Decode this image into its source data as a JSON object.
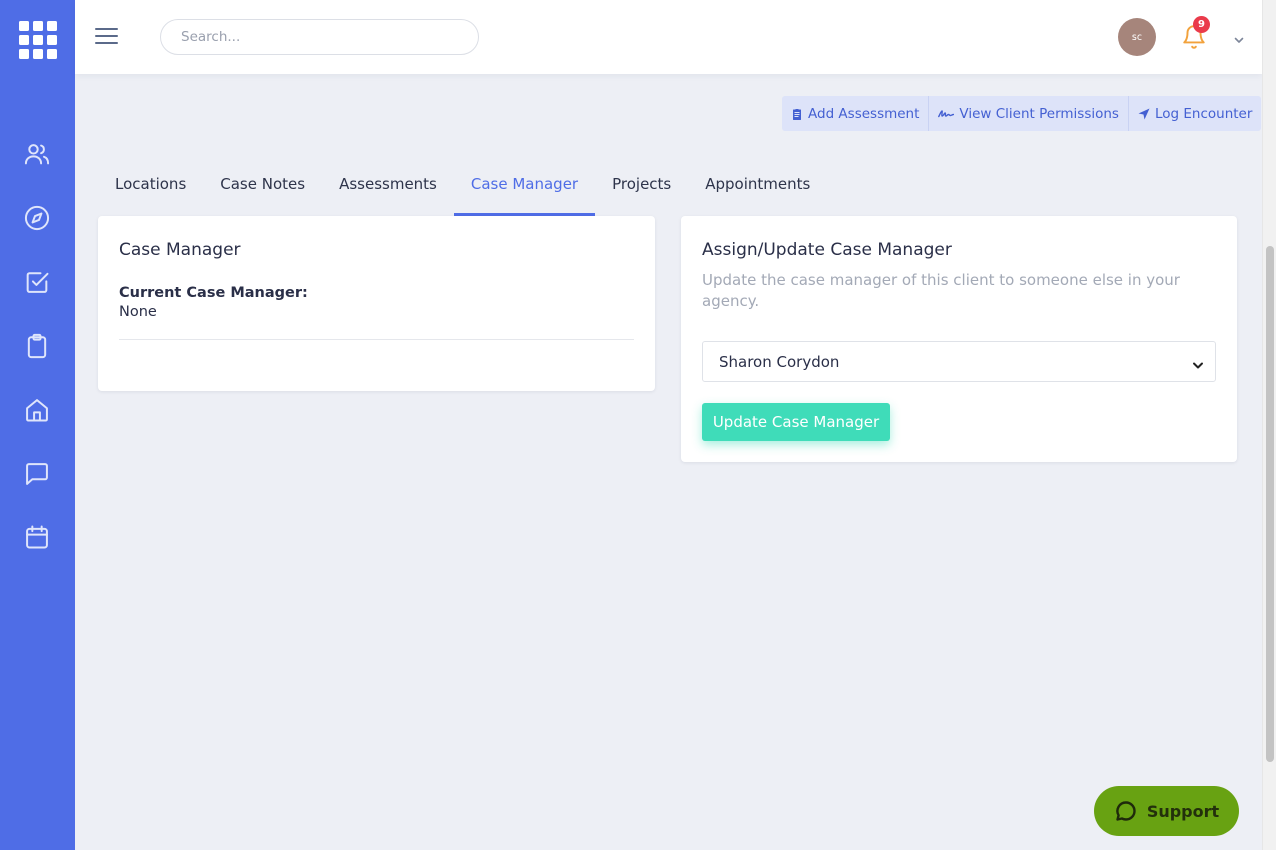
{
  "sidebar": {
    "apps_icon": "grid-icon",
    "items": [
      {
        "icon": "users-icon"
      },
      {
        "icon": "compass-icon"
      },
      {
        "icon": "checkbox-icon"
      },
      {
        "icon": "clipboard-icon"
      },
      {
        "icon": "home-icon"
      },
      {
        "icon": "message-icon"
      },
      {
        "icon": "calendar-icon"
      }
    ],
    "color": "#4f6de6"
  },
  "header": {
    "search_placeholder": "Search...",
    "avatar_initials": "sc",
    "notification_count": "9"
  },
  "actions": [
    {
      "label": "Add Assessment",
      "icon": "clipboard-icon"
    },
    {
      "label": "View Client Permissions",
      "icon": "signature-icon"
    },
    {
      "label": "Log Encounter",
      "icon": "location-arrow-icon"
    }
  ],
  "tabs": [
    {
      "label": "Locations"
    },
    {
      "label": "Case Notes"
    },
    {
      "label": "Assessments"
    },
    {
      "label": "Case Manager",
      "active": true
    },
    {
      "label": "Projects"
    },
    {
      "label": "Appointments"
    }
  ],
  "case_manager_card": {
    "title": "Case Manager",
    "current_label": "Current Case Manager:",
    "current_value": "None"
  },
  "assign_card": {
    "title": "Assign/Update Case Manager",
    "description": "Update the case manager of this client to someone else in your agency.",
    "selected_option": "Sharon Corydon",
    "button_label": "Update Case Manager",
    "button_color": "#3fdcb9"
  },
  "support": {
    "label": "Support",
    "color": "#68a212"
  }
}
